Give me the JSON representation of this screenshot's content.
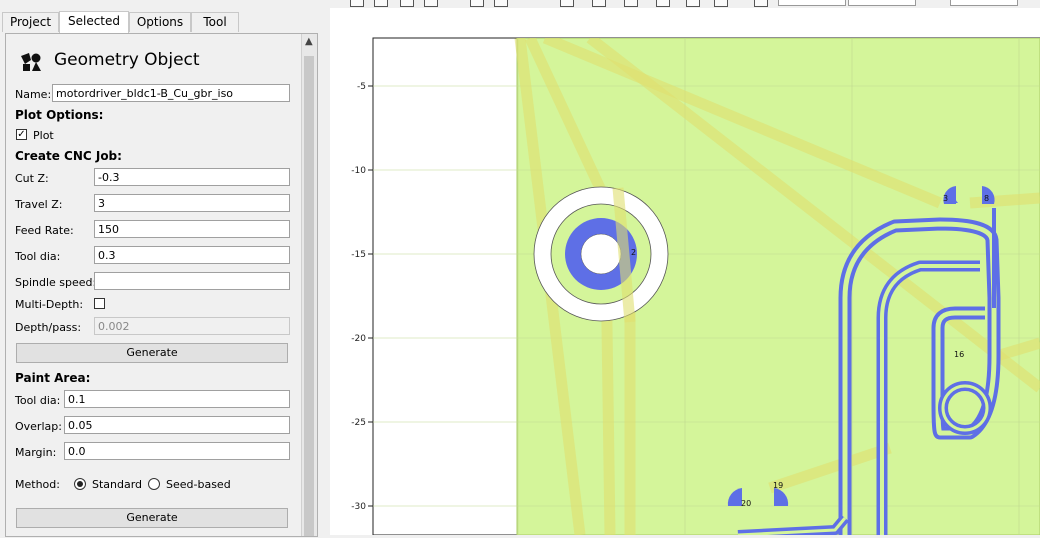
{
  "tabs": [
    "Project",
    "Selected",
    "Options",
    "Tool"
  ],
  "active_tab": "Selected",
  "panel": {
    "title": "Geometry Object",
    "name_label": "Name:",
    "name_value": "motordriver_bldc1-B_Cu_gbr_iso",
    "plot_options_label": "Plot Options:",
    "plot_label": "Plot",
    "plot_checked": true,
    "cnc_label": "Create CNC Job:",
    "cut_z_label": "Cut Z:",
    "cut_z_value": "-0.3",
    "travel_z_label": "Travel Z:",
    "travel_z_value": "3",
    "feed_rate_label": "Feed Rate:",
    "feed_rate_value": "150",
    "tool_dia_label": "Tool dia:",
    "tool_dia_value": "0.3",
    "spindle_label": "Spindle speed:",
    "spindle_value": "",
    "multi_depth_label": "Multi-Depth:",
    "multi_depth_checked": false,
    "depth_label": "Depth/pass:",
    "depth_value": "0.002",
    "generate_label": "Generate",
    "paint_label": "Paint Area:",
    "paint_tool_dia_label": "Tool dia:",
    "paint_tool_dia_value": "0.1",
    "overlap_label": "Overlap:",
    "overlap_value": "0.05",
    "margin_label": "Margin:",
    "margin_value": "0.0",
    "method_label": "Method:",
    "method_standard": "Standard",
    "method_seed": "Seed-based",
    "method_selected": "Standard",
    "generate2_label": "Generate"
  },
  "plot": {
    "y_ticks": [
      "-5",
      "-10",
      "-15",
      "-20",
      "-25",
      "-30"
    ],
    "pad_labels": [
      "2",
      "3",
      "8",
      "16",
      "19",
      "20"
    ],
    "colors": {
      "board": "#d4f59a",
      "board_edge": "#aacc66",
      "trace": "#5e6fe6",
      "isolation": "#e0e070",
      "grid": "#c0d890"
    }
  }
}
